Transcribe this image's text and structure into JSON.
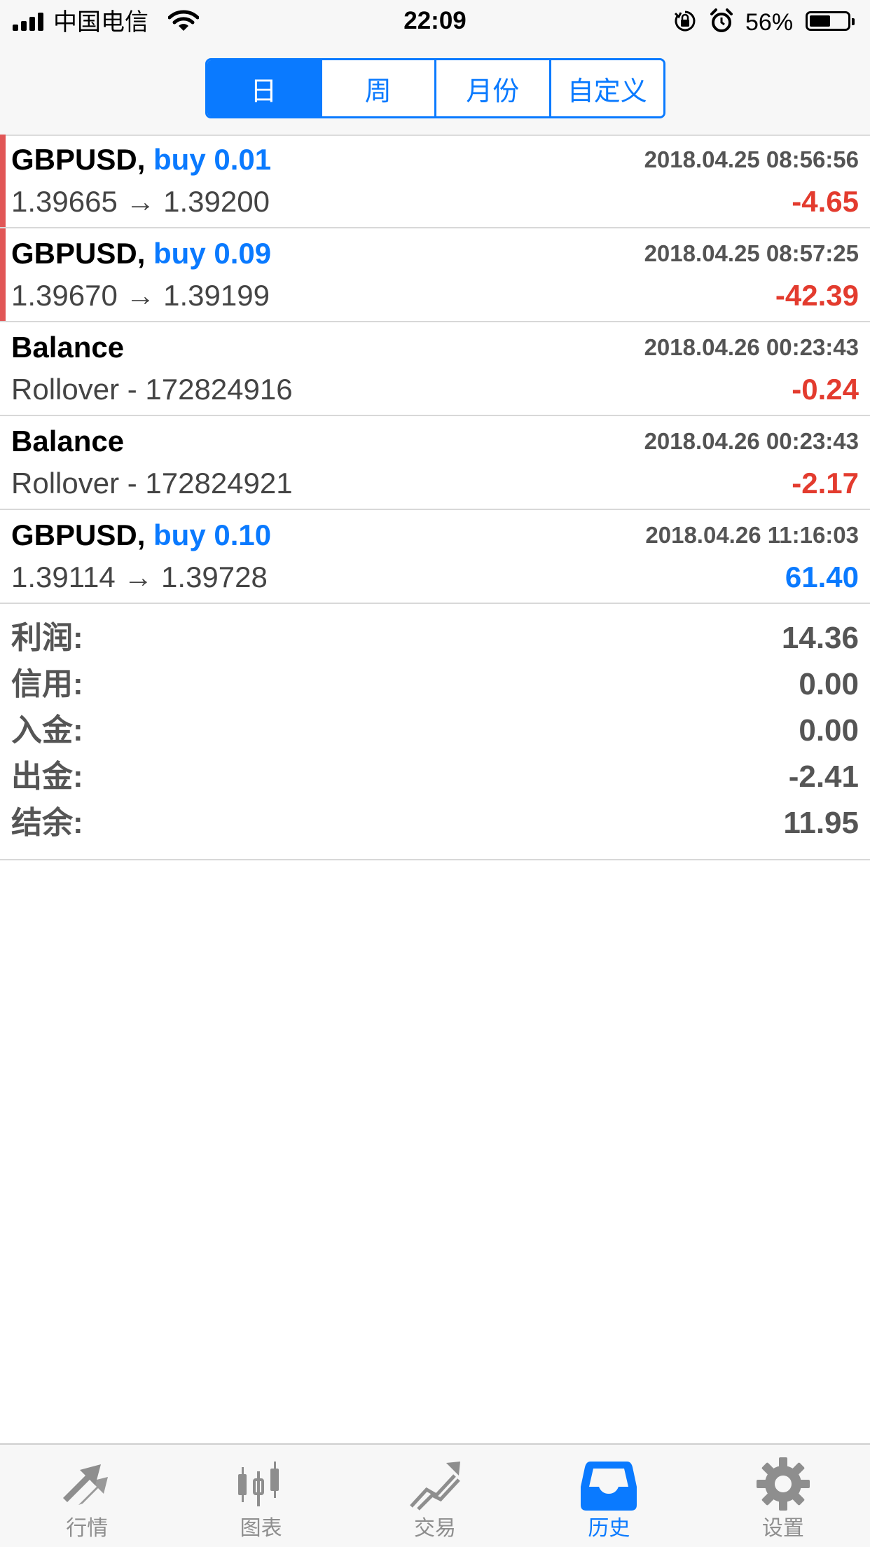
{
  "status_bar": {
    "carrier": "中国电信",
    "time": "22:09",
    "battery_percent": "56%",
    "battery_level": 0.56,
    "icons": [
      "signal-icon",
      "wifi-icon",
      "orientation-lock-icon",
      "alarm-icon",
      "battery-icon"
    ]
  },
  "period_tabs": {
    "items": [
      {
        "label": "日",
        "active": true
      },
      {
        "label": "周",
        "active": false
      },
      {
        "label": "月份",
        "active": false
      },
      {
        "label": "自定义",
        "active": false
      }
    ]
  },
  "deals": [
    {
      "symbol": "GBPUSD,",
      "action": "buy 0.01",
      "time": "2018.04.25 08:56:56",
      "detail": "1.39665 → 1.39200",
      "pnl": "-4.65",
      "pnl_type": "negative"
    },
    {
      "symbol": "GBPUSD,",
      "action": "buy 0.09",
      "time": "2018.04.25 08:57:25",
      "detail": "1.39670 → 1.39199",
      "pnl": "-42.39",
      "pnl_type": "negative"
    },
    {
      "symbol": "Balance",
      "action": "",
      "time": "2018.04.26 00:23:43",
      "detail": "Rollover - 172824916",
      "pnl": "-0.24",
      "pnl_type": "negative"
    },
    {
      "symbol": "Balance",
      "action": "",
      "time": "2018.04.26 00:23:43",
      "detail": "Rollover - 172824921",
      "pnl": "-2.17",
      "pnl_type": "negative"
    },
    {
      "symbol": "GBPUSD,",
      "action": "buy 0.10",
      "time": "2018.04.26 11:16:03",
      "detail": "1.39114 → 1.39728",
      "pnl": "61.40",
      "pnl_type": "positive"
    }
  ],
  "summary": {
    "profit_label": "利润:",
    "profit_value": "14.36",
    "credit_label": "信用:",
    "credit_value": "0.00",
    "deposit_label": "入金:",
    "deposit_value": "0.00",
    "withdrawal_label": "出金:",
    "withdrawal_value": "-2.41",
    "balance_label": "结余:",
    "balance_value": "11.95"
  },
  "tab_bar": {
    "items": [
      {
        "label": "行情",
        "icon": "quotes-arrows-icon",
        "active": false
      },
      {
        "label": "图表",
        "icon": "candlestick-chart-icon",
        "active": false
      },
      {
        "label": "交易",
        "icon": "trade-chart-icon",
        "active": false
      },
      {
        "label": "历史",
        "icon": "history-inbox-icon",
        "active": true
      },
      {
        "label": "设置",
        "icon": "settings-gear-icon",
        "active": false
      }
    ]
  },
  "colors": {
    "accent": "#0a7aff",
    "loss": "#e33b2e",
    "loss_bar": "#e15656",
    "inactive_tab": "#8e8e8e"
  }
}
